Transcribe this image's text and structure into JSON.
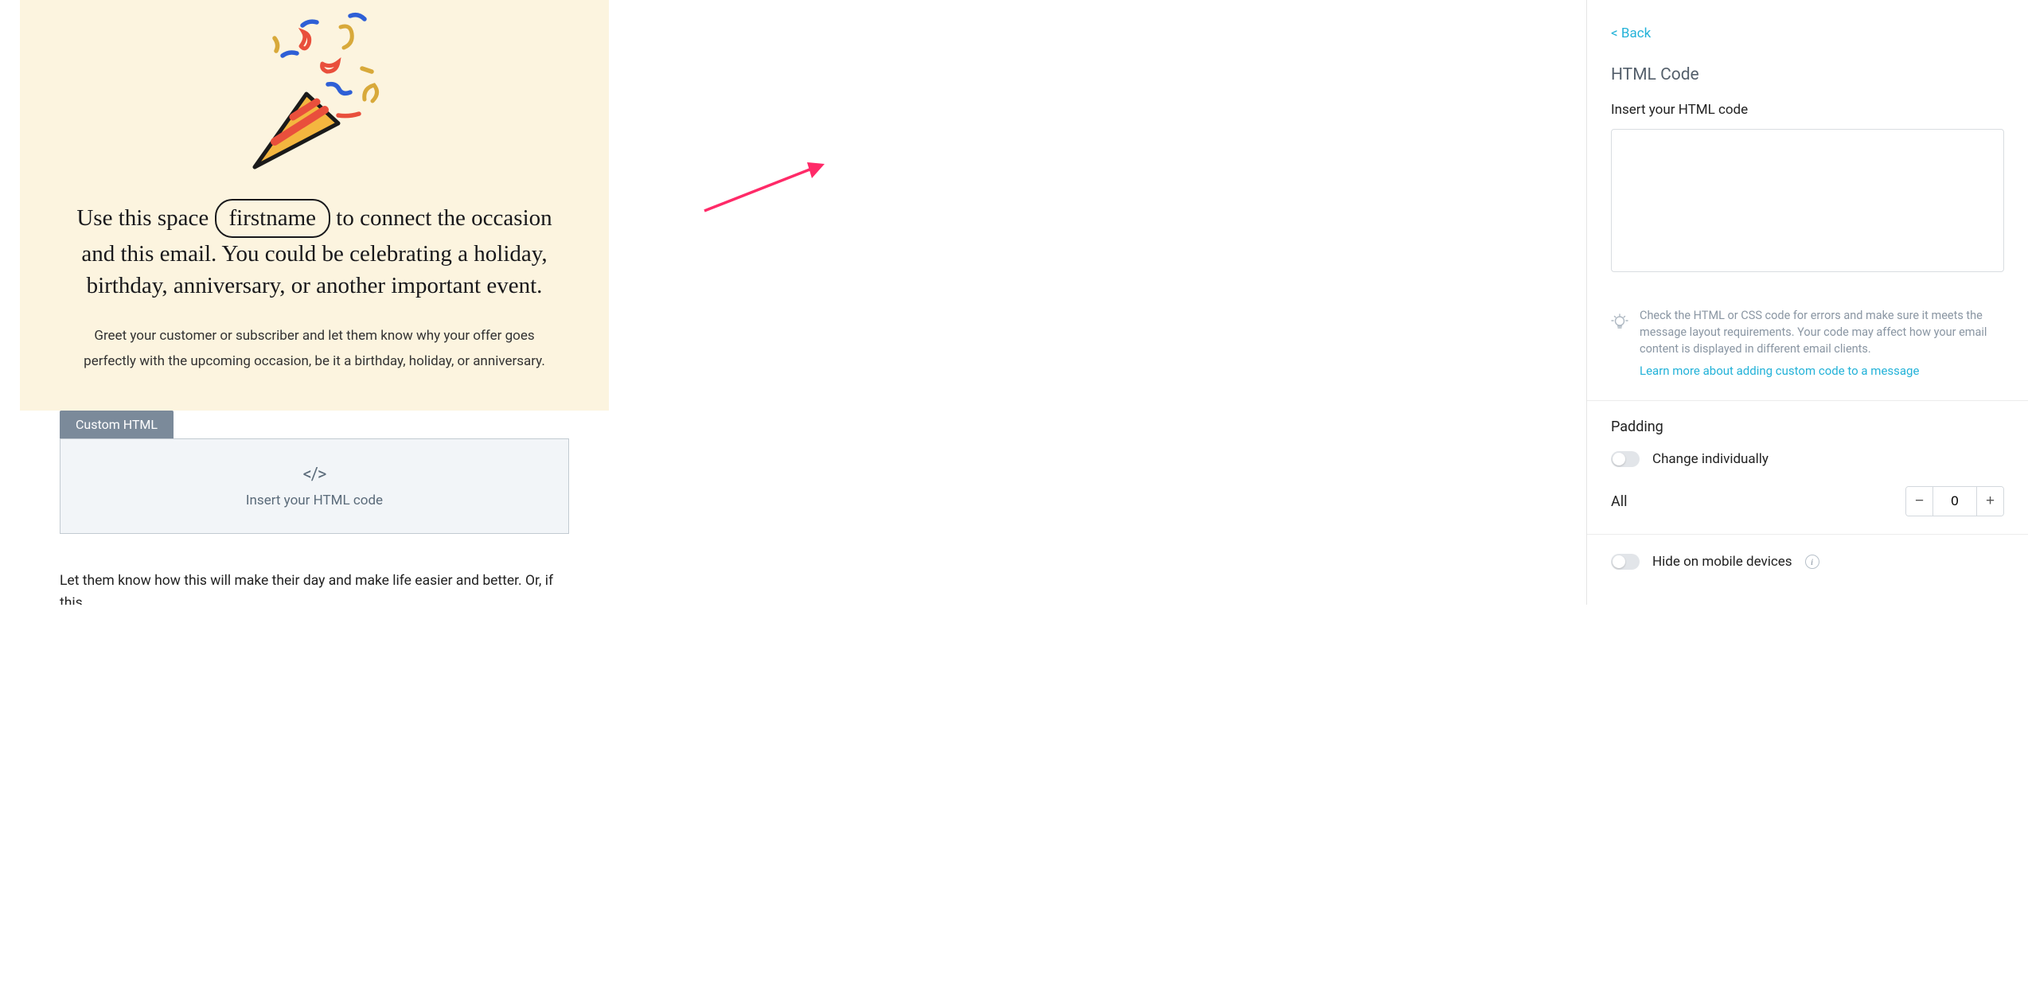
{
  "sidebar": {
    "back": "< Back",
    "heading": "HTML Code",
    "insert_label": "Insert your HTML code",
    "hint": "Check the HTML or CSS code for errors and make sure it meets the message layout requirements. Your code may affect how your email content is displayed in different email clients.",
    "hint_link": "Learn more about adding custom code to a message",
    "padding_title": "Padding",
    "padding_toggle": "Change individually",
    "padding_all": "All",
    "padding_value": "0",
    "minus": "−",
    "plus": "+",
    "hide_mobile": "Hide on mobile devices"
  },
  "canvas": {
    "hero_text_1": "Use this space",
    "hero_pill": "firstname",
    "hero_text_2": "to connect the occasion and this email. You could be celebrating a holiday, birthday, anniversary, or another important event.",
    "hero_sub": "Greet your customer or subscriber and let them know why your offer goes perfectly with the upcoming occasion, be it a birthday, holiday, or anniversary.",
    "custom_tab": "Custom HTML",
    "code_icon": "</>",
    "custom_placeholder": "Insert your HTML code",
    "below": "Let them know how this will make their day and make life easier and better. Or, if this"
  },
  "info_glyph": "i"
}
